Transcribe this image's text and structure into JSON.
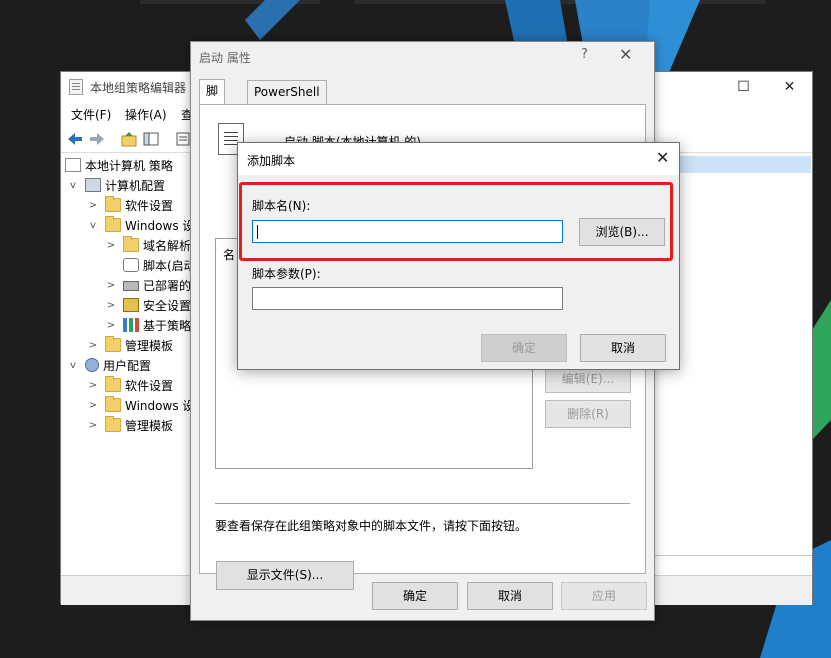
{
  "gpedit": {
    "title": "本地组策略编辑器",
    "menu": [
      "文件(F)",
      "操作(A)",
      "查"
    ],
    "tree": [
      {
        "label": "本地计算机 策略",
        "icon": "policy-doc-icon",
        "expander": ""
      },
      {
        "label": "计算机配置",
        "icon": "computer-icon",
        "expander": "v"
      },
      {
        "label": "软件设置",
        "icon": "folder-icon",
        "expander": ">"
      },
      {
        "label": "Windows 设",
        "icon": "folder-icon",
        "expander": "v"
      },
      {
        "label": "域名解析",
        "icon": "folder-icon",
        "expander": ">"
      },
      {
        "label": "脚本(启动",
        "icon": "script-icon",
        "expander": ""
      },
      {
        "label": "已部署的",
        "icon": "printer-icon",
        "expander": ">"
      },
      {
        "label": "安全设置",
        "icon": "shield-icon",
        "expander": ">"
      },
      {
        "label": "基于策略",
        "icon": "chart-icon",
        "expander": ">"
      },
      {
        "label": "管理模板",
        "icon": "folder-icon",
        "expander": ">"
      },
      {
        "label": "用户配置",
        "icon": "user-icon",
        "expander": "v"
      },
      {
        "label": "软件设置",
        "icon": "folder-icon",
        "expander": ">"
      },
      {
        "label": "Windows 设",
        "icon": "folder-icon",
        "expander": ">"
      },
      {
        "label": "管理模板",
        "icon": "folder-icon",
        "expander": ">"
      }
    ]
  },
  "properties": {
    "title": "启动 属性",
    "help": "?",
    "close": "✕",
    "tabs": [
      "脚本",
      "PowerShell 脚本"
    ],
    "heading": "启动 脚本(本地计算机 的)",
    "list_header": "名",
    "edit_button": "编辑(E)...",
    "delete_button": "删除(R)",
    "hint": "要查看保存在此组策略对象中的脚本文件，请按下面按钮。",
    "show_files_button": "显示文件(S)...",
    "ok_button": "确定",
    "cancel_button": "取消",
    "apply_button": "应用"
  },
  "add_script": {
    "title": "添加脚本",
    "close": "✕",
    "script_name_label": "脚本名(N):",
    "script_name_value": "",
    "browse_button": "浏览(B)...",
    "script_params_label": "脚本参数(P):",
    "script_params_value": "",
    "ok_button": "确定",
    "cancel_button": "取消",
    "highlight_color": "#e01e1e"
  },
  "colors": {
    "accent": "#0078d7",
    "dialog_bg": "#f0f0f0",
    "desktop_bg": "#1d1d1d"
  }
}
